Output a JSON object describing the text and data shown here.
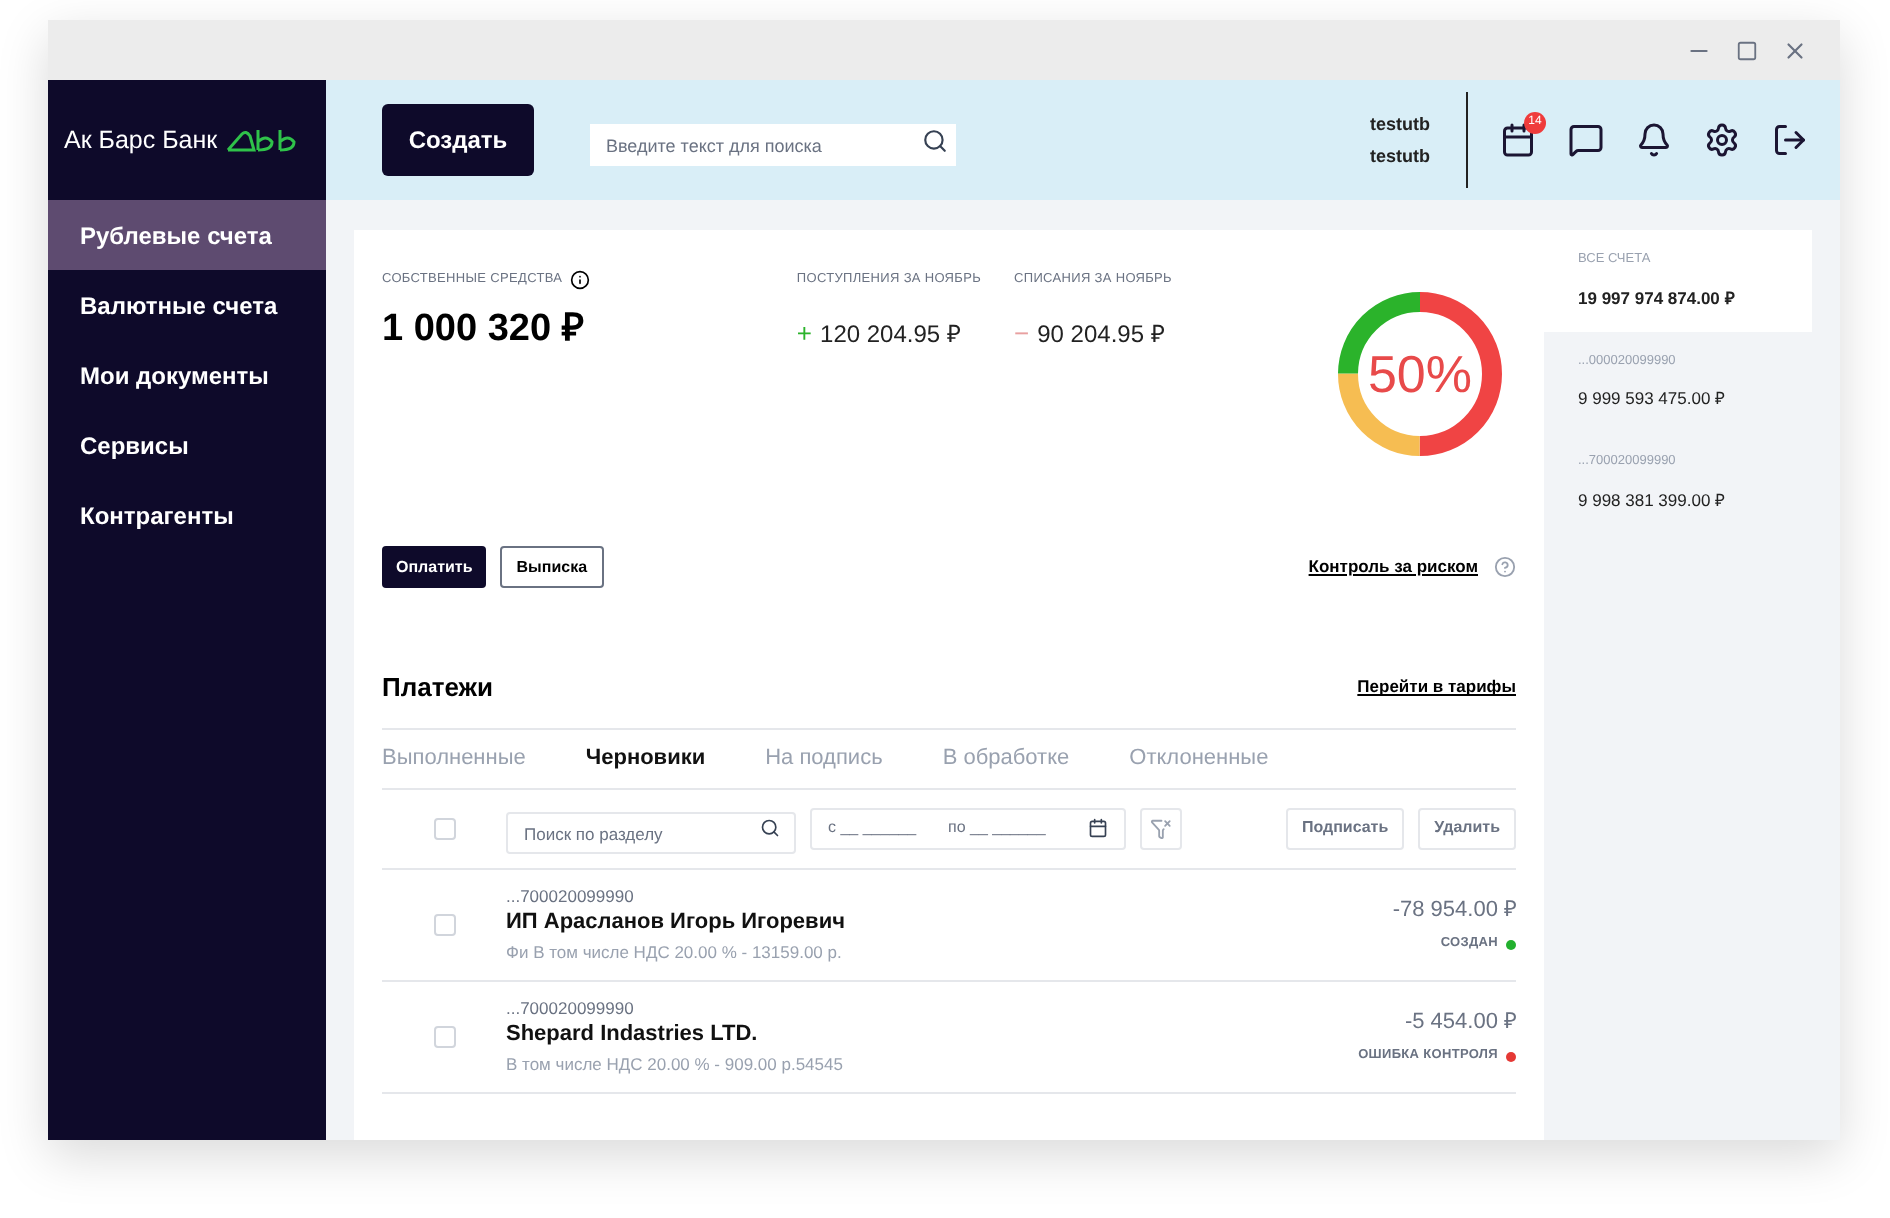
{
  "logo": {
    "text": "Ак Барс Банк"
  },
  "sidebar": {
    "items": [
      {
        "label": "Рублевые счета",
        "selected": true
      },
      {
        "label": "Валютные счета",
        "selected": false
      },
      {
        "label": "Мои документы",
        "selected": false
      },
      {
        "label": "Сервисы",
        "selected": false
      },
      {
        "label": "Контрагенты",
        "selected": false
      }
    ]
  },
  "header": {
    "create_button": "Создать",
    "search": {
      "placeholder": "Введите текст для поиска"
    },
    "user": [
      "testutb",
      "testutb"
    ],
    "calendar_badge": "14"
  },
  "summary": {
    "own_funds": {
      "label": "СОБСТВЕННЫЕ СРЕДСТВА",
      "value": "1 000 320 ₽"
    },
    "income": {
      "label": "ПОСТУПЛЕНИЯ ЗА НОЯБРЬ",
      "sign": "+",
      "value": "120 204.95 ₽"
    },
    "expense": {
      "label": "СПИСАНИЯ ЗА НОЯБРЬ",
      "sign": "−",
      "value": "90 204.95 ₽"
    },
    "risk_meter": {
      "level": 0.5,
      "reading": "50%"
    },
    "pay_button": "Оплатить",
    "statement_button": "Выписка",
    "risk_link": "Контроль за риском"
  },
  "payments": {
    "title": "Платежи",
    "tariffs_link": "Перейти в тарифы",
    "tabs": [
      {
        "label": "Выполненные",
        "selected": false
      },
      {
        "label": "Черновики",
        "selected": true
      },
      {
        "label": "На подпись",
        "selected": false
      },
      {
        "label": "В обработке",
        "selected": false
      },
      {
        "label": "Отклоненные",
        "selected": false
      }
    ],
    "toolbar": {
      "select_all_checked": false,
      "search": {
        "placeholder": "Поиск по разделу"
      },
      "date_from": {
        "placeholder": "с __ ______"
      },
      "date_to": {
        "placeholder": "по __ ______"
      },
      "sign_button": "Подписать",
      "delete_button": "Удалить"
    },
    "rows": [
      {
        "account": "...700020099990",
        "name": "ИП Арасланов Игорь Игоревич",
        "details": "Фи В том числе НДС 20.00 % - 13159.00 р.",
        "amount": "-78 954.00 ₽",
        "status": "СОЗДАН",
        "color": "#22b02e",
        "checked": false
      },
      {
        "account": "...700020099990",
        "name": "Shepard Indastries LTD.",
        "details": "В том числе НДС 20.00 % - 909.00 р.54545",
        "amount": "-5 454.00 ₽",
        "status": "ОШИБКА КОНТРОЛЯ",
        "color": "#e53935",
        "checked": false
      }
    ]
  },
  "accounts": [
    {
      "label": "ВСЕ СЧЕТА",
      "amount": "19 997 974 874.00 ₽",
      "selected": true
    },
    {
      "label": "...000020099990",
      "amount": "9 999 593 475.00 ₽",
      "selected": false
    },
    {
      "label": "...700020099990",
      "amount": "9 998 381 399.00 ₽",
      "selected": false
    }
  ]
}
